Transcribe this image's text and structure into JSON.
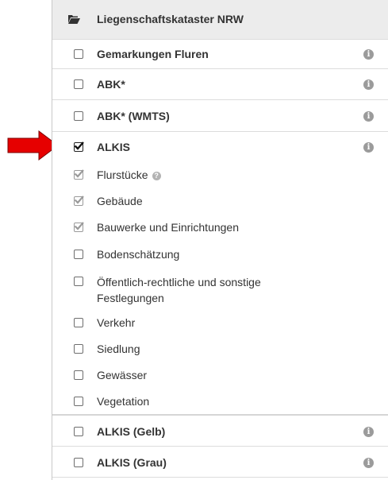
{
  "header": {
    "title": "Liegenschaftskataster NRW",
    "icon": "folder-open-icon"
  },
  "layers": [
    {
      "label": "Gemarkungen Fluren",
      "checked": false,
      "info": "i"
    },
    {
      "label": "ABK*",
      "checked": false,
      "info": "i"
    },
    {
      "label": "ABK* (WMTS)",
      "checked": false,
      "info": "i"
    },
    {
      "label": "ALKIS",
      "checked": true,
      "info": "i",
      "sublayers": [
        {
          "label": "Flurstücke",
          "checked": true,
          "help": "?"
        },
        {
          "label": "Gebäude",
          "checked": true
        },
        {
          "label": "Bauwerke und Einrichtungen",
          "checked": true
        },
        {
          "label": "Bodenschätzung",
          "checked": false
        },
        {
          "label_line1": "Öffentlich-rechtliche und sonstige",
          "label_line2": "Festlegungen",
          "checked": false
        },
        {
          "label": "Verkehr",
          "checked": false
        },
        {
          "label": "Siedlung",
          "checked": false
        },
        {
          "label": "Gewässer",
          "checked": false
        },
        {
          "label": "Vegetation",
          "checked": false
        }
      ]
    },
    {
      "label": "ALKIS (Gelb)",
      "checked": false,
      "info": "i"
    },
    {
      "label": "ALKIS (Grau)",
      "checked": false,
      "info": "i"
    }
  ],
  "colors": {
    "arrow": "#e60000",
    "header_bg": "#ececec",
    "info_icon": "#9b9b9b"
  }
}
